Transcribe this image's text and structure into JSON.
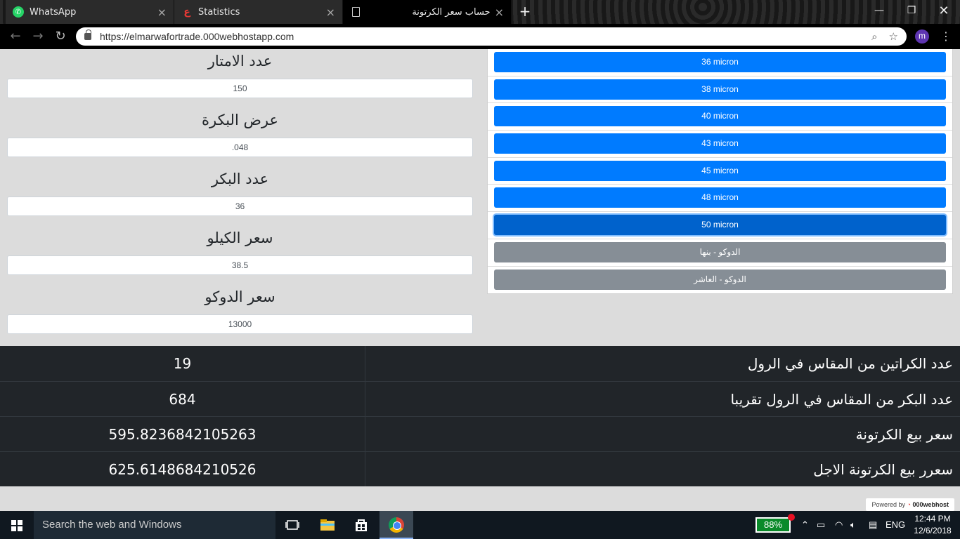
{
  "browser": {
    "tabs": [
      {
        "title": "WhatsApp",
        "icon": "whatsapp-icon"
      },
      {
        "title": "Statistics",
        "icon": "statistics-icon"
      },
      {
        "title": "حساب سعر الكرتونة",
        "icon": "page-icon"
      }
    ],
    "url": "https://elmarwafortrade.000webhostapp.com",
    "profile_initial": "m"
  },
  "form": {
    "meters_label": "عدد الامتار",
    "meters_value": "150",
    "roll_width_label": "عرض البكرة",
    "roll_width_value": ".048",
    "rolls_count_label": "عدد البكر",
    "rolls_count_value": "36",
    "kilo_price_label": "سعر الكيلو",
    "kilo_price_value": "38.5",
    "doco_price_label": "سعر الدوكو",
    "doco_price_value": "13000"
  },
  "microns": {
    "items": [
      "36 micron",
      "38 micron",
      "40 micron",
      "43 micron",
      "45 micron",
      "48 micron",
      "50 micron"
    ],
    "selected": "50 micron",
    "doco_benha": "الدوكو - بنها",
    "doco_ashr": "الدوكو - العاشر"
  },
  "results": [
    {
      "label": "عدد الكراتين من المقاس في الرول",
      "value": "19"
    },
    {
      "label": "عدد البكر من المقاس في الرول تقريبا",
      "value": "684"
    },
    {
      "label": "سعر بيع الكرتونة",
      "value": "595.8236842105263"
    },
    {
      "label": "سعرر بيع الكرتونة الاجل",
      "value": "625.6148684210526"
    }
  ],
  "powered_by": {
    "prefix": "Powered by",
    "brand": "000webhost"
  },
  "taskbar": {
    "search_placeholder": "Search the web and Windows",
    "battery": "88%",
    "language": "ENG",
    "time": "12:44 PM",
    "date": "12/6/2018"
  },
  "colors": {
    "primary_button": "#007bff",
    "secondary_button": "#868e96",
    "results_background": "#212529"
  }
}
